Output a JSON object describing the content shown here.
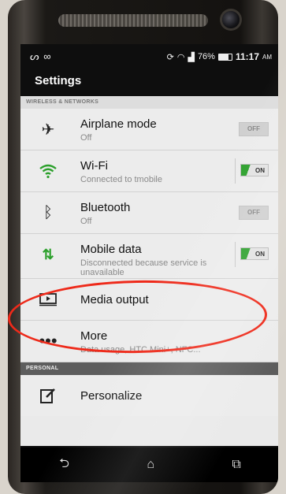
{
  "status_bar": {
    "left_icons": "ᔕ ∞",
    "battery": "76%",
    "time": "11:17",
    "ampm": "AM"
  },
  "header": {
    "title": "Settings"
  },
  "sections": [
    {
      "title": "WIRELESS & NETWORKS"
    },
    {
      "title": "PERSONAL"
    }
  ],
  "items": [
    {
      "label": "Airplane mode",
      "sub": "Off",
      "toggle": "OFF",
      "icon": "airplane-icon"
    },
    {
      "label": "Wi-Fi",
      "sub": "Connected to tmobile",
      "toggle": "ON",
      "icon": "wifi-icon"
    },
    {
      "label": "Bluetooth",
      "sub": "Off",
      "toggle": "OFF",
      "icon": "bluetooth-icon"
    },
    {
      "label": "Mobile data",
      "sub": "Disconnected because service is unavailable",
      "toggle": "ON",
      "icon": "mobile-data-icon"
    },
    {
      "label": "Media output",
      "icon": "media-output-icon"
    },
    {
      "label": "More",
      "sub": "Data usage, HTC Mini+, NFC...",
      "icon": "more-icon"
    },
    {
      "label": "Personalize",
      "icon": "personalize-icon"
    }
  ],
  "colors": {
    "highlight": "#ee2a1a",
    "toggle_on": "#2ca02c"
  }
}
